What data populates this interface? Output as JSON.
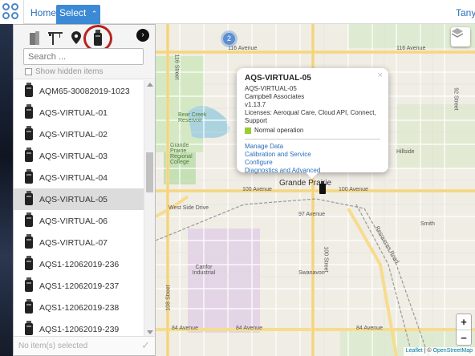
{
  "topbar": {
    "home_label": "Home",
    "select_label": "Select",
    "user_name": "Tanya"
  },
  "sidebar": {
    "tabs": [
      {
        "icon": "building-icon"
      },
      {
        "icon": "crane-icon"
      },
      {
        "icon": "location-pin-icon"
      },
      {
        "icon": "device-icon"
      }
    ],
    "search_placeholder": "Search ...",
    "show_hidden_label": "Show hidden items",
    "items": [
      {
        "label": "AQM65-30082019-1023",
        "selected": false
      },
      {
        "label": "AQS-VIRTUAL-01",
        "selected": false
      },
      {
        "label": "AQS-VIRTUAL-02",
        "selected": false
      },
      {
        "label": "AQS-VIRTUAL-03",
        "selected": false
      },
      {
        "label": "AQS-VIRTUAL-04",
        "selected": false
      },
      {
        "label": "AQS-VIRTUAL-05",
        "selected": true
      },
      {
        "label": "AQS-VIRTUAL-06",
        "selected": false
      },
      {
        "label": "AQS-VIRTUAL-07",
        "selected": false
      },
      {
        "label": "AQS1-12062019-236",
        "selected": false
      },
      {
        "label": "AQS1-12062019-237",
        "selected": false
      },
      {
        "label": "AQS1-12062019-238",
        "selected": false
      },
      {
        "label": "AQS1-12062019-239",
        "selected": false
      }
    ],
    "footer_text": "No item(s) selected"
  },
  "map": {
    "cluster_count": "2",
    "labels": {
      "ave116": "116 Avenue",
      "ave116b": "116 Avenue",
      "ave100": "100 Avenue",
      "ave100b": "100 Avenue",
      "ave97": "97 Avenue",
      "ave84": "84 Avenue",
      "ave84b": "84 Avenue",
      "ave84c": "84 Avenue",
      "west_side": "West Side Drive",
      "city": "Grande Prairie",
      "swanavon": "Swanavon",
      "canfor": "Canfor Industrial",
      "college": "Grande Prairie Regional College",
      "bear_creek": "Bear Creek Reservoir",
      "hillside": "Hillside",
      "smith": "Smith",
      "resources": "Resources Road",
      "st108": "108 Street",
      "st100": "100 Street",
      "st92": "92 Street",
      "st116": "116 Street"
    },
    "zoom_in": "+",
    "zoom_out": "−",
    "attribution_leaflet": "Leaflet",
    "attribution_sep": " | © ",
    "attribution_osm": "OpenStreetMap"
  },
  "popup": {
    "title": "AQS-VIRTUAL-05",
    "name": "AQS-VIRTUAL-05",
    "owner": "Campbell Associates",
    "version": "v1.13.7",
    "licenses": "Licenses: Aeroqual Care, Cloud API, Connect, Support",
    "status": "Normal operation",
    "status_color": "#9acd32",
    "links": [
      "Manage Data",
      "Calibration and Service",
      "Configure",
      "Diagnostics and Advanced"
    ],
    "close_label": "×"
  },
  "colors": {
    "accent": "#3c8ad6",
    "highlight_circle": "#b8231e",
    "link": "#2a6ebb"
  }
}
